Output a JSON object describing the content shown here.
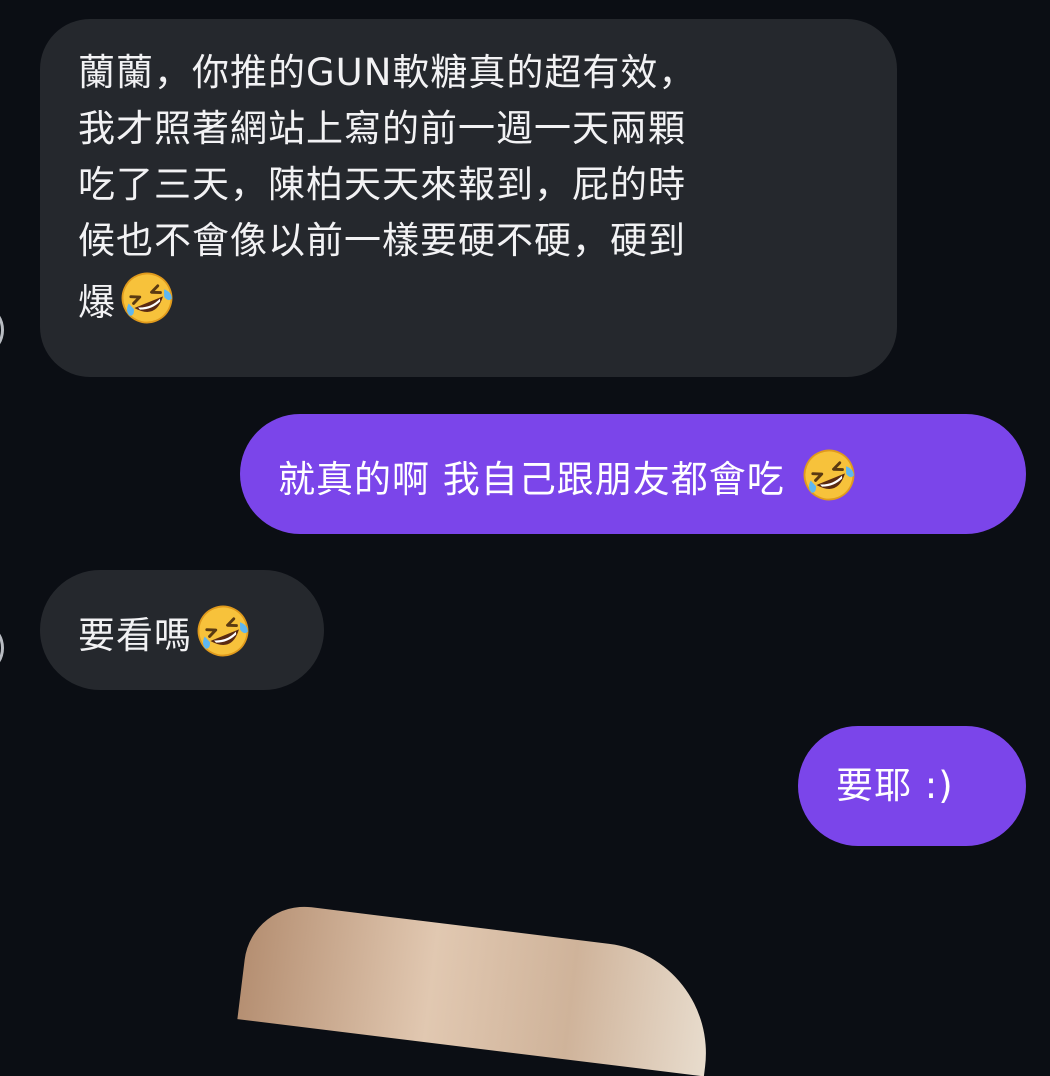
{
  "messages": [
    {
      "direction": "incoming",
      "lines": [
        "蘭蘭，你推的GUN軟糖真的超有效，",
        "我才照著網站上寫的前一週一天兩顆",
        "吃了三天，陳柏天天來報到，屁的時",
        "候也不會像以前一樣要硬不硬，硬到",
        "爆"
      ],
      "emoji": "rolling-on-floor-laughing-icon"
    },
    {
      "direction": "outgoing",
      "text": "就真的啊 我自己跟朋友都會吃 ",
      "emoji": "rolling-on-floor-laughing-icon"
    },
    {
      "direction": "incoming",
      "text": "要看嗎",
      "emoji": "rolling-on-floor-laughing-icon"
    },
    {
      "direction": "outgoing",
      "text": "要耶 :)"
    }
  ],
  "colors": {
    "background": "#0b0e14",
    "incoming_bubble": "#25282d",
    "outgoing_bubble": "#7b45ea",
    "text": "#f2f2f4"
  }
}
